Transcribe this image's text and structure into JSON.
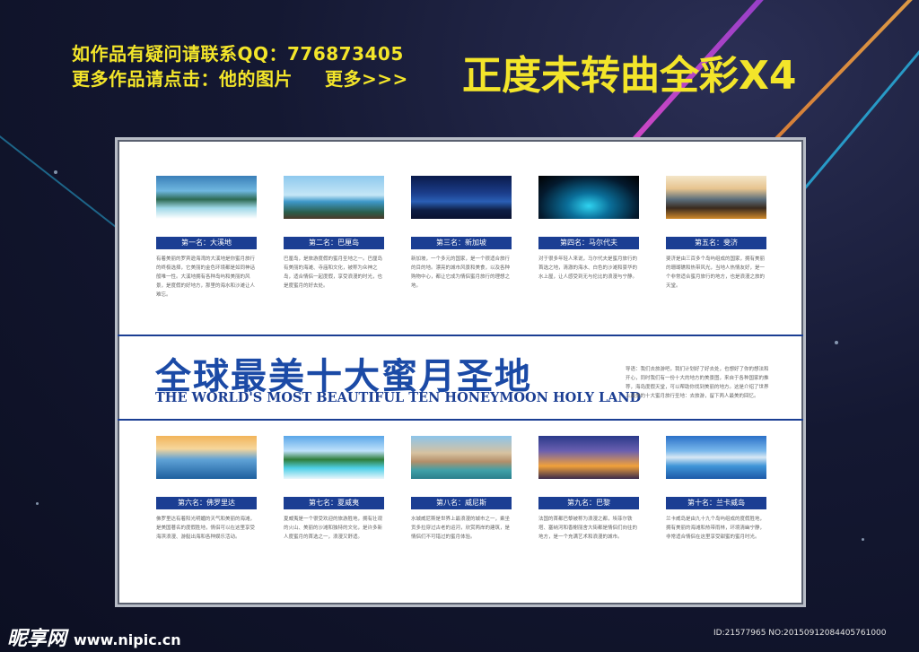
{
  "header": {
    "notice_line1": "如作品有疑问请联系QQ：776873405",
    "notice_line2": "更多作品请点击：他的图片",
    "notice_more": "更多>>>",
    "headline": "正度未转曲全彩X4"
  },
  "colors": {
    "accent_blue": "#1b3e93",
    "headline_yellow": "#f3e52a"
  },
  "poster": {
    "title_cn": "全球最美十大蜜月圣地",
    "title_en": "THE WORLD'S MOST BEAUTIFUL TEN HONEYMOON HOLY LAND",
    "intro": "导语：我们去旅游吧，我们计划好了好去处，也想好了你的想法和开心，同时我们有一份十大的地方的美景图，来自于各种国家的推荐，海岛度假天堂，可以帮助你找到美丽的地方。这是介绍了世界上最美的十大蜜月旅行圣地：去旅游，留下两人最美的回忆。",
    "top_destinations": [
      {
        "rank_label": "第一名：大溪地",
        "photo_icon": "lagoon-photo",
        "desc": "有着美丽的罗宾逊海湾的大溪地是你蜜月旅行的终极选择，它美丽的金色环境都是如同神话般唯一性。大溪地拥有各种岛屿和美丽的风景，是度假的好地方，那里的海水和沙滩让人难忘。"
      },
      {
        "rank_label": "第二名：巴厘岛",
        "photo_icon": "beach-photo",
        "desc": "巴厘岛，是旅游度假的蜜月圣地之一。巴厘岛有美丽的海滩、寺庙和文化，被称为众神之岛，适合情侣一起度假，享受浪漫的时光，也是度蜜月的好去处。"
      },
      {
        "rank_label": "第三名：新加坡",
        "photo_icon": "skyline-photo",
        "desc": "新加坡，一个多元的国家，是一个很适合旅行的目的地。漂亮的城市风景和美食，以及各种购物中心，都让它成为情侣蜜月旅行的理想之地。"
      },
      {
        "rank_label": "第四名：马尔代夫",
        "photo_icon": "night-pool-photo",
        "desc": "对于很多年轻人来说，马尔代夫是蜜月旅行的首选之地，清澈的海水、白色的沙滩和豪华的水上屋，让人感受到无与伦比的浪漫与宁静。"
      },
      {
        "rank_label": "第五名：斐济",
        "photo_icon": "sunset-pier-photo",
        "desc": "斐济是由三百多个岛屿组成的国家，拥有美丽的珊瑚礁和热带风光，当地人热情友好，是一个非常适合蜜月旅行的地方，也是浪漫之旅的天堂。"
      }
    ],
    "bottom_destinations": [
      {
        "rank_label": "第六名：佛罗里达",
        "photo_icon": "yacht-photo",
        "desc": "佛罗里达有着阳光明媚的天气和美丽的海滩，是美国著名的度假胜地，情侣可以在这里享受海滨浪漫、游艇出海和各种娱乐活动。"
      },
      {
        "rank_label": "第七名：夏威夷",
        "photo_icon": "resort-pool-photo",
        "desc": "夏威夷是一个很受欢迎的旅游胜地，拥有壮观的火山、美丽的沙滩和独特的文化，是许多新人度蜜月的首选之一，浪漫又舒适。"
      },
      {
        "rank_label": "第八名：威尼斯",
        "photo_icon": "canal-photo",
        "desc": "水城威尼斯是世界上最浪漫的城市之一，乘坐贡多拉穿过古老的运河，欣赏两岸的建筑，是情侣们不可错过的蜜月体验。"
      },
      {
        "rank_label": "第九名：巴黎",
        "photo_icon": "eiffel-photo",
        "desc": "法国的首都巴黎被称为浪漫之都，埃菲尔铁塔、塞纳河和香榭丽舍大街都是情侣们向往的地方，是一个充满艺术和浪漫的城市。"
      },
      {
        "rank_label": "第十名：兰卡威岛",
        "photo_icon": "infinity-pool-photo",
        "desc": "兰卡威岛是由九十九个岛屿组成的度假胜地，拥有美丽的海滩和热带雨林，环境清幽宁静，非常适合情侣在这里享受甜蜜的蜜月时光。"
      }
    ]
  },
  "footer": {
    "watermark_cn": "昵享网",
    "watermark_site": "www.nipic.cn",
    "id_text": "ID:21577965 NO:20150912084405761000"
  }
}
